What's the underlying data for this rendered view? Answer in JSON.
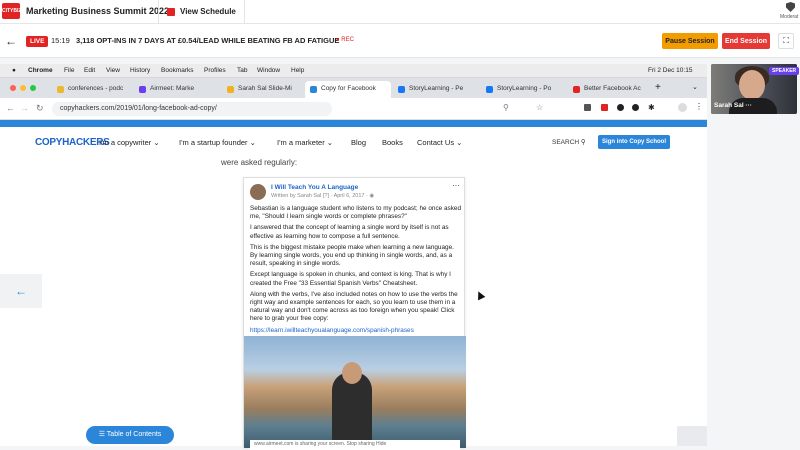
{
  "topbar": {
    "logo_text": "CITYBIZ",
    "event_title": "Marketing Business Summit 2022",
    "view_schedule": "View Schedule",
    "role": "Moderat"
  },
  "session": {
    "live": "LIVE",
    "timer": "15:19",
    "title": "3,118 OPT-INS IN 7 DAYS AT £0.54/LEAD WHILE BEATING FB AD FATIGUE",
    "rec": "● REC",
    "pause": "Pause Session",
    "end": "End Session"
  },
  "mac": {
    "app": "Chrome",
    "menus": [
      "File",
      "Edit",
      "View",
      "History",
      "Bookmarks",
      "Profiles",
      "Tab",
      "Window",
      "Help"
    ],
    "clock": "Fri 2 Dec  10:15"
  },
  "tabs": [
    {
      "label": "conferences - podc",
      "color": "#e8b931"
    },
    {
      "label": "Airmeet: Marke",
      "color": "#6a3ff0"
    },
    {
      "label": "Sarah Sal Slide-Mi",
      "color": "#f2b21b"
    },
    {
      "label": "Copy for Facebook",
      "color": "#2b86d9"
    },
    {
      "label": "StoryLearning - Pe",
      "color": "#1877f2"
    },
    {
      "label": "StoryLearning - Po",
      "color": "#1877f2"
    },
    {
      "label": "Better Facebook Ac",
      "color": "#e02424"
    }
  ],
  "browser": {
    "url": "copyhackers.com/2019/01/long-facebook-ad-copy/"
  },
  "site": {
    "logo": "COPYHACKERS",
    "nav": [
      "I'm a copywriter ⌄",
      "I'm a startup founder ⌄",
      "I'm a marketer ⌄",
      "Blog",
      "Books",
      "Contact Us ⌄"
    ],
    "search": "SEARCH",
    "signin": "Sign into Copy School"
  },
  "article": {
    "text": "were asked regularly:"
  },
  "post": {
    "name": "I Will Teach You A Language",
    "meta": "Written by Sarah Sal [?] · April 6, 2017 · ◉",
    "paragraphs": [
      "Sebastian is a language student who listens to my podcast; he once asked me, \"Should I learn single words or complete phrases?\"",
      "I answered that the concept of learning a single word by itself is not as effective as learning how to compose a full sentence.",
      "This is the biggest mistake people make when learning a new language. By learning single words, you end up thinking in single words, and, as a result, speaking in single words.",
      "Except language is spoken in chunks, and context is king. That is why I created the Free \"33 Essential Spanish Verbs\" Cheatsheet.",
      "Along with the verbs, I've also included notes on how to use the verbs the right way and example sentences for each, so you learn to use them in a natural way and don't come across as too foreign when you speak! Click here to grab your free copy:"
    ],
    "link": "https://learn.iwillteachyoualanguage.com/spanish-phrases"
  },
  "share_bar": "www.airmeet.com is sharing your screen.     Stop sharing     Hide",
  "toc": "☰ Table of Contents",
  "speaker": {
    "tag": "SPEAKER",
    "name": "Sarah Sal ···"
  }
}
